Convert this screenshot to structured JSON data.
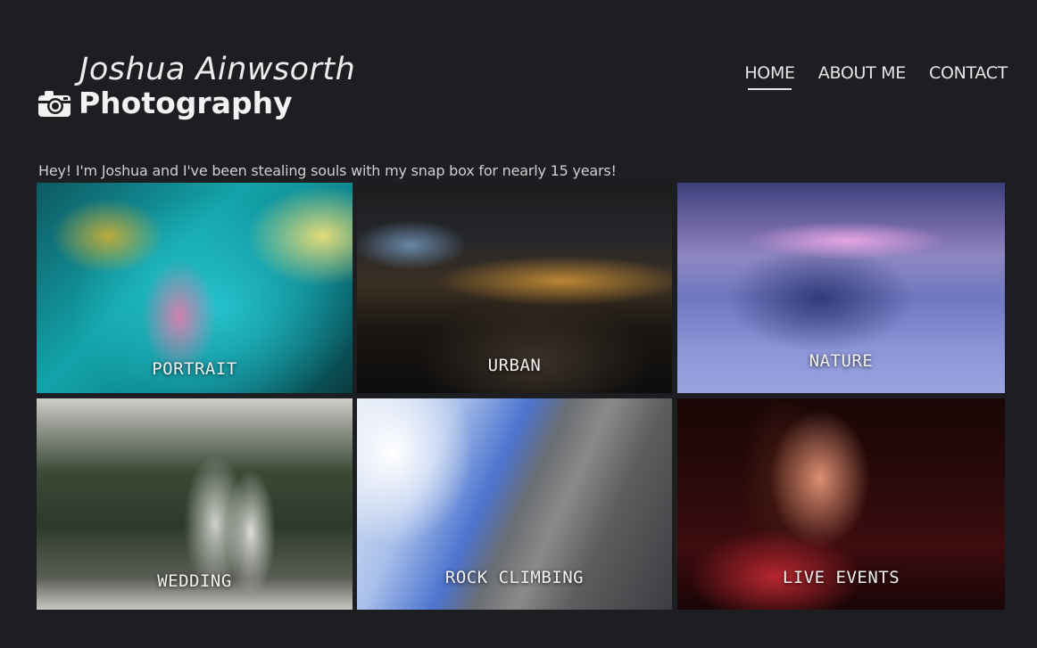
{
  "header": {
    "name": "Joshua Ainwsorth",
    "subtitle": "Photography",
    "logo_icon": "camera-icon"
  },
  "nav": {
    "items": [
      {
        "label": "HOME",
        "active": true
      },
      {
        "label": "ABOUT ME",
        "active": false
      },
      {
        "label": "CONTACT",
        "active": false
      }
    ]
  },
  "intro": "Hey! I'm Joshua and I've been stealing souls with my snap box for nearly 15 years!",
  "gallery": {
    "tiles": [
      {
        "label": "PORTRAIT"
      },
      {
        "label": "URBAN"
      },
      {
        "label": "NATURE"
      },
      {
        "label": "WEDDING"
      },
      {
        "label": "ROCK CLIMBING"
      },
      {
        "label": "LIVE EVENTS"
      }
    ]
  }
}
